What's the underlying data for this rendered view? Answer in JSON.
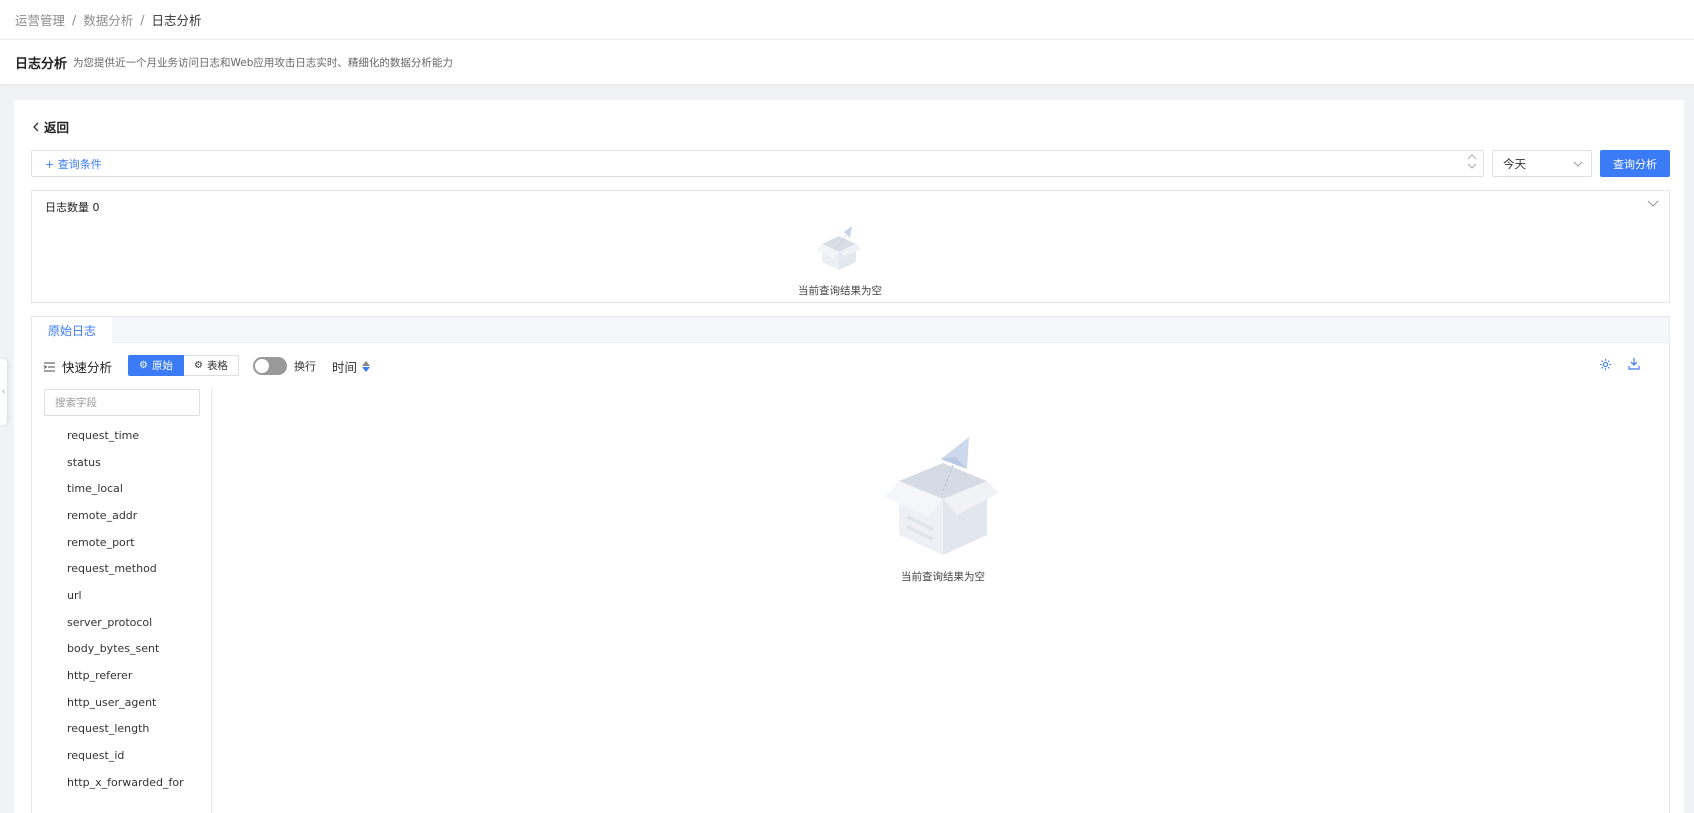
{
  "breadcrumb": {
    "items": [
      "运营管理",
      "数据分析",
      "日志分析"
    ]
  },
  "header": {
    "title": "日志分析",
    "description": "为您提供近一个月业务访问日志和Web应用攻击日志实时、精细化的数据分析能力"
  },
  "query": {
    "back_label": "返回",
    "add_condition_label": "+ 查询条件",
    "date_range_value": "今天",
    "submit_label": "查询分析"
  },
  "log_count": {
    "label": "日志数量 0",
    "empty_text": "当前查询结果为空"
  },
  "tabs": {
    "raw_log": "原始日志"
  },
  "toolbar": {
    "quick_analysis_label": "快速分析",
    "view_raw_label": "原始",
    "view_table_label": "表格",
    "wrap_label": "换行",
    "time_sort_label": "时间"
  },
  "fields": {
    "search_placeholder": "搜索字段",
    "items": [
      "request_time",
      "status",
      "time_local",
      "remote_addr",
      "remote_port",
      "request_method",
      "url",
      "server_protocol",
      "body_bytes_sent",
      "http_referer",
      "http_user_agent",
      "request_length",
      "request_id",
      "http_x_forwarded_for"
    ]
  },
  "results": {
    "empty_text": "当前查询结果为空"
  },
  "colors": {
    "primary": "#3b7bf6",
    "border": "#dcdfe6"
  }
}
